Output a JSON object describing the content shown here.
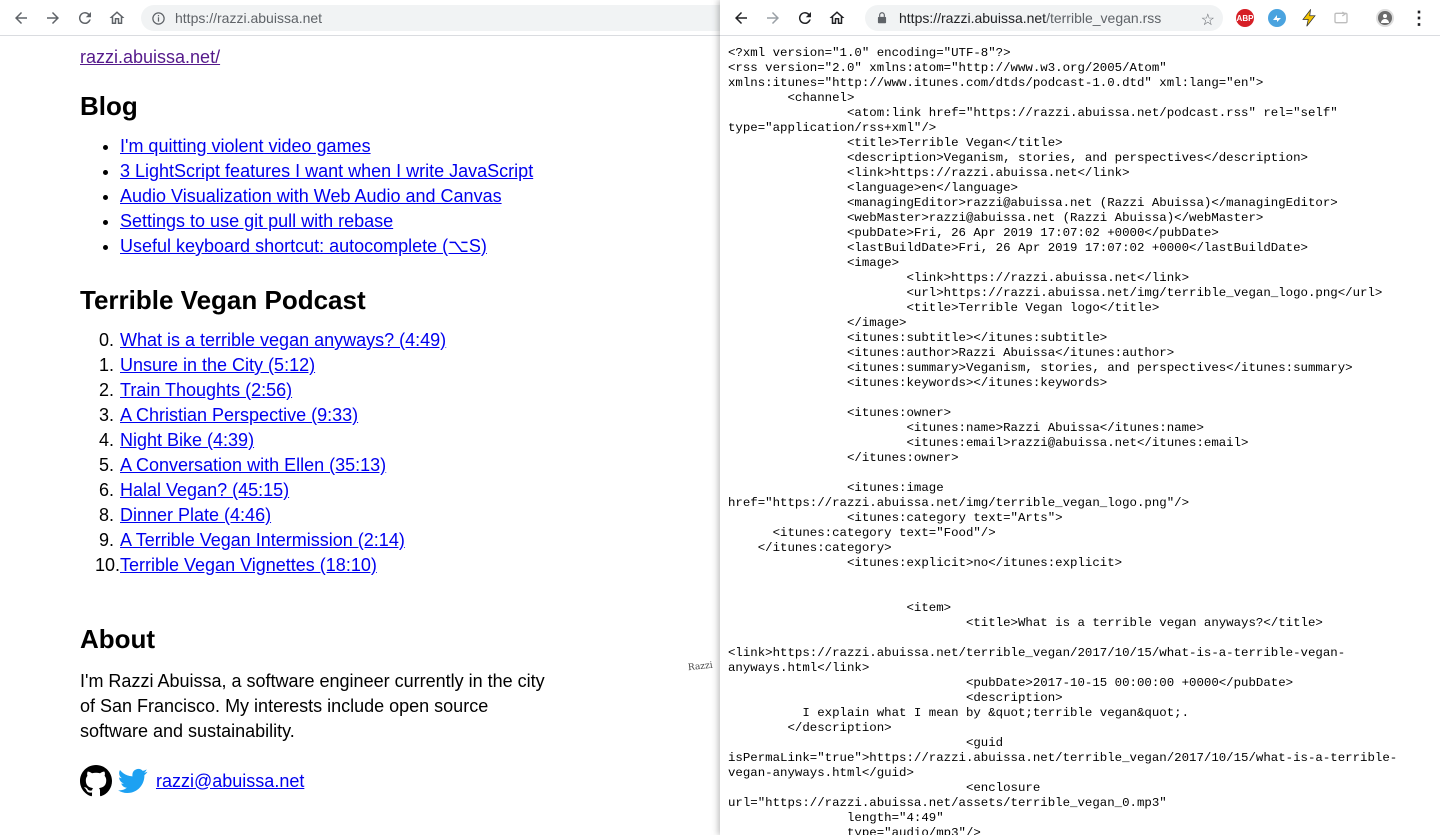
{
  "left_window": {
    "url": "https://razzi.abuissa.net",
    "site_link": "razzi.abuissa.net/",
    "blog": {
      "title": "Blog",
      "posts": [
        "I'm quitting violent video games",
        "3 LightScript features I want when I write JavaScript",
        "Audio Visualization with Web Audio and Canvas",
        "Settings to use git pull with rebase",
        "Useful keyboard shortcut: autocomplete (⌥S)"
      ]
    },
    "podcast": {
      "title": "Terrible Vegan Podcast",
      "episodes": [
        {
          "num": "0.",
          "label": "What is a terrible vegan anyways? (4:49)"
        },
        {
          "num": "1.",
          "label": "Unsure in the City (5:12)"
        },
        {
          "num": "2.",
          "label": "Train Thoughts (2:56)"
        },
        {
          "num": "3.",
          "label": "A Christian Perspective (9:33)"
        },
        {
          "num": "4.",
          "label": "Night Bike (4:39)"
        },
        {
          "num": "5.",
          "label": "A Conversation with Ellen (35:13)"
        },
        {
          "num": "6.",
          "label": "Halal Vegan? (45:15)"
        },
        {
          "num": "8.",
          "label": "Dinner Plate (4:46)"
        },
        {
          "num": "9.",
          "label": "A Terrible Vegan Intermission (2:14)"
        },
        {
          "num": "10.",
          "label": "Terrible Vegan Vignettes (18:10)"
        }
      ]
    },
    "about": {
      "title": "About",
      "text": "I'm Razzi Abuissa, a software engineer currently in the city of San Francisco. My interests include open source software and sustainability.",
      "email": "razzi@abuissa.net"
    }
  },
  "right_window": {
    "url_host": "https://razzi.abuissa.net",
    "url_path": "/terrible_vegan.rss",
    "extensions": [
      {
        "name": "adblock-plus-icon",
        "label": "ABP",
        "color": "#d61f26"
      },
      {
        "name": "tweetdeck-icon",
        "label": "",
        "color": "#4aa3df"
      },
      {
        "name": "lightning-extension-icon",
        "label": "",
        "color": "#f2c200"
      },
      {
        "name": "cast-icon",
        "label": "",
        "color": "#c7c7c7"
      },
      {
        "name": "profile-avatar-icon",
        "label": "",
        "color": "#6b6b6b"
      }
    ],
    "xml_lines": [
      "<?xml version=\"1.0\" encoding=\"UTF-8\"?>",
      "<rss version=\"2.0\" xmlns:atom=\"http://www.w3.org/2005/Atom\"",
      "xmlns:itunes=\"http://www.itunes.com/dtds/podcast-1.0.dtd\" xml:lang=\"en\">",
      "        <channel>",
      "                <atom:link href=\"https://razzi.abuissa.net/podcast.rss\" rel=\"self\"",
      "type=\"application/rss+xml\"/>",
      "                <title>Terrible Vegan</title>",
      "                <description>Veganism, stories, and perspectives</description>",
      "                <link>https://razzi.abuissa.net</link>",
      "                <language>en</language>",
      "                <managingEditor>razzi@abuissa.net (Razzi Abuissa)</managingEditor>",
      "                <webMaster>razzi@abuissa.net (Razzi Abuissa)</webMaster>",
      "                <pubDate>Fri, 26 Apr 2019 17:07:02 +0000</pubDate>",
      "                <lastBuildDate>Fri, 26 Apr 2019 17:07:02 +0000</lastBuildDate>",
      "                <image>",
      "                        <link>https://razzi.abuissa.net</link>",
      "                        <url>https://razzi.abuissa.net/img/terrible_vegan_logo.png</url>",
      "                        <title>Terrible Vegan logo</title>",
      "                </image>",
      "                <itunes:subtitle></itunes:subtitle>",
      "                <itunes:author>Razzi Abuissa</itunes:author>",
      "                <itunes:summary>Veganism, stories, and perspectives</itunes:summary>",
      "                <itunes:keywords></itunes:keywords>",
      "",
      "                <itunes:owner>",
      "                        <itunes:name>Razzi Abuissa</itunes:name>",
      "                        <itunes:email>razzi@abuissa.net</itunes:email>",
      "                </itunes:owner>",
      "",
      "                <itunes:image",
      "href=\"https://razzi.abuissa.net/img/terrible_vegan_logo.png\"/>",
      "                <itunes:category text=\"Arts\">",
      "      <itunes:category text=\"Food\"/>",
      "    </itunes:category>",
      "                <itunes:explicit>no</itunes:explicit>",
      "",
      "",
      "                        <item>",
      "                                <title>What is a terrible vegan anyways?</title>",
      "",
      "<link>https://razzi.abuissa.net/terrible_vegan/2017/10/15/what-is-a-terrible-vegan-",
      "anyways.html</link>",
      "                                <pubDate>2017-10-15 00:00:00 +0000</pubDate>",
      "                                <description>",
      "          I explain what I mean by &quot;terrible vegan&quot;.",
      "        </description>",
      "                                <guid",
      "isPermaLink=\"true\">https://razzi.abuissa.net/terrible_vegan/2017/10/15/what-is-a-terrible-",
      "vegan-anyways.html</guid>",
      "                                <enclosure",
      "url=\"https://razzi.abuissa.net/assets/terrible_vegan_0.mp3\"",
      "                length=\"4:49\"",
      "                type=\"audio/mp3\"/>"
    ]
  },
  "stray_text": "Razzi"
}
